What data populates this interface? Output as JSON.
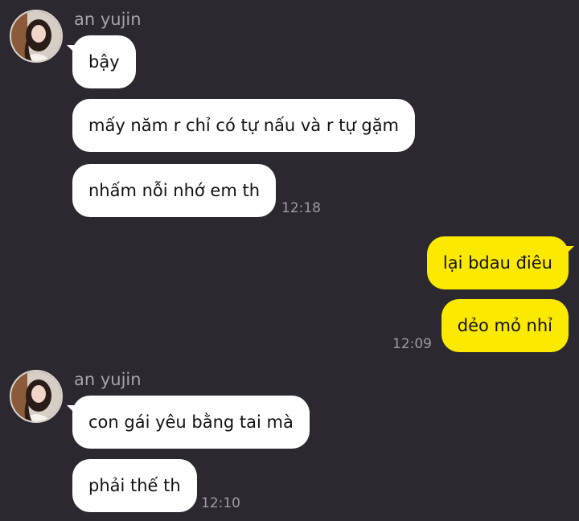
{
  "colors": {
    "background": "#2b2830",
    "incoming_bubble": "#ffffff",
    "outgoing_bubble": "#fce900",
    "sender_name": "#a7a3aa",
    "timestamp": "#9e9aa2"
  },
  "groups": [
    {
      "sender": "an yujin",
      "messages": [
        "bậy",
        "mấy năm r chỉ có tự nấu và r tự gặm",
        "nhấm nỗi nhớ em th"
      ],
      "time": "12:18"
    },
    {
      "messages": [
        "lại bdau điêu",
        "dẻo mỏ nhỉ"
      ],
      "time": "12:09"
    },
    {
      "sender": "an yujin",
      "messages": [
        "con gái yêu bằng tai mà",
        "phải thế th"
      ],
      "time": "12:10"
    }
  ]
}
